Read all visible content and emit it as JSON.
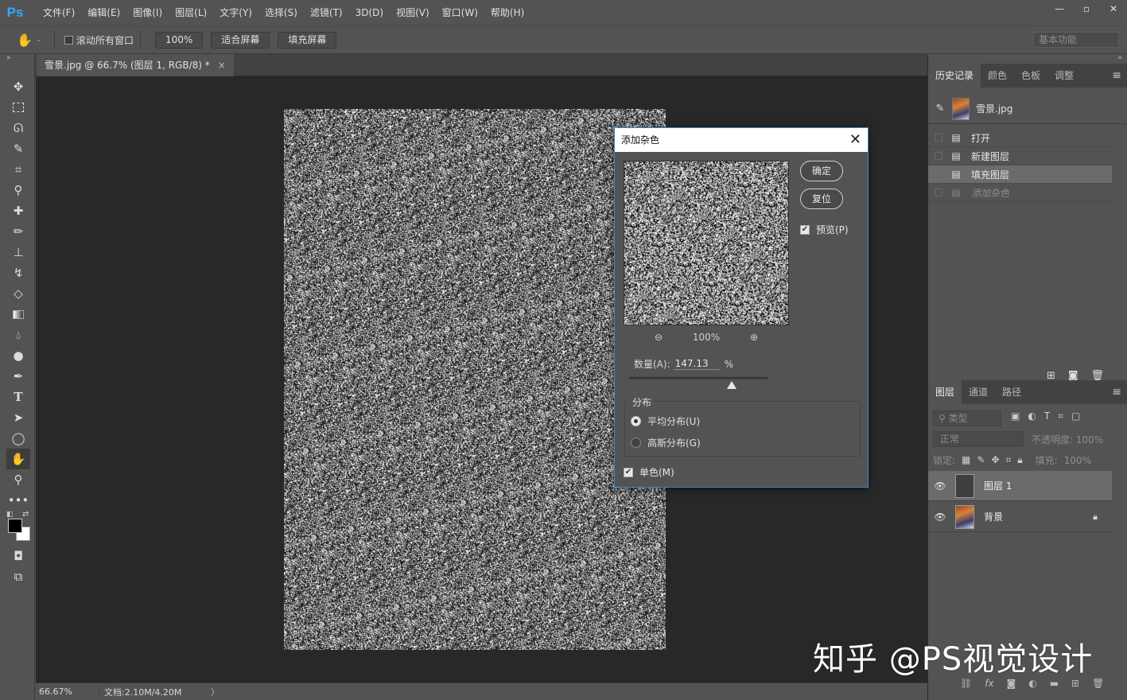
{
  "app": {
    "logo": "Ps"
  },
  "menu": [
    "文件(F)",
    "编辑(E)",
    "图像(I)",
    "图层(L)",
    "文字(Y)",
    "选择(S)",
    "滤镜(T)",
    "3D(D)",
    "视图(V)",
    "窗口(W)",
    "帮助(H)"
  ],
  "window_controls": {
    "minimize": "—",
    "restore": "▫",
    "close": "✕"
  },
  "options": {
    "scroll_all_label": "滚动所有窗口",
    "zoom_value": "100%",
    "fit_screen": "适合屏幕",
    "fill_screen": "填充屏幕",
    "workspace": "基本功能"
  },
  "document": {
    "tab_title": "雪景.jpg @ 66.7% (图层 1, RGB/8) *",
    "tab_close": "×"
  },
  "status": {
    "zoom": "66.67%",
    "doc_size": "文档:2.10M/4.20M",
    "arrow": "〉"
  },
  "history_panel": {
    "tabs": [
      "历史记录",
      "颜色",
      "色板",
      "调整"
    ],
    "snapshot": "雪景.jpg",
    "items": [
      {
        "label": "打开",
        "state": "normal"
      },
      {
        "label": "新建图层",
        "state": "normal"
      },
      {
        "label": "填充图层",
        "state": "selected"
      },
      {
        "label": "添加杂色",
        "state": "dim"
      }
    ]
  },
  "layers_panel": {
    "tabs": [
      "图层",
      "通道",
      "路径"
    ],
    "filter_label": "类型",
    "blend_mode": "正常",
    "opacity_label": "不透明度:",
    "opacity_value": "100%",
    "lock_label": "锁定:",
    "fill_label": "填充:",
    "fill_value": "100%",
    "layers": [
      {
        "name": "图层 1",
        "selected": true
      },
      {
        "name": "背景",
        "selected": false,
        "locked": true
      }
    ]
  },
  "dialog": {
    "title": "添加杂色",
    "ok": "确定",
    "reset": "复位",
    "preview_label": "预览(P)",
    "preview_checked": true,
    "zoom_value": "100%",
    "amount_label": "数量(A):",
    "amount_value": "147.13",
    "amount_unit": "%",
    "amount_slider_fraction": 0.74,
    "distribution_label": "分布",
    "uniform_label": "平均分布(U)",
    "gaussian_label": "高斯分布(G)",
    "selected_distribution": "uniform",
    "mono_label": "单色(M)",
    "mono_checked": true
  },
  "watermark": "知乎 @PS视觉设计",
  "colors": {
    "accent": "#31a8ff",
    "dialog_border": "#3b86d6",
    "panel_bg": "#535353",
    "canvas_bg": "#282828"
  }
}
